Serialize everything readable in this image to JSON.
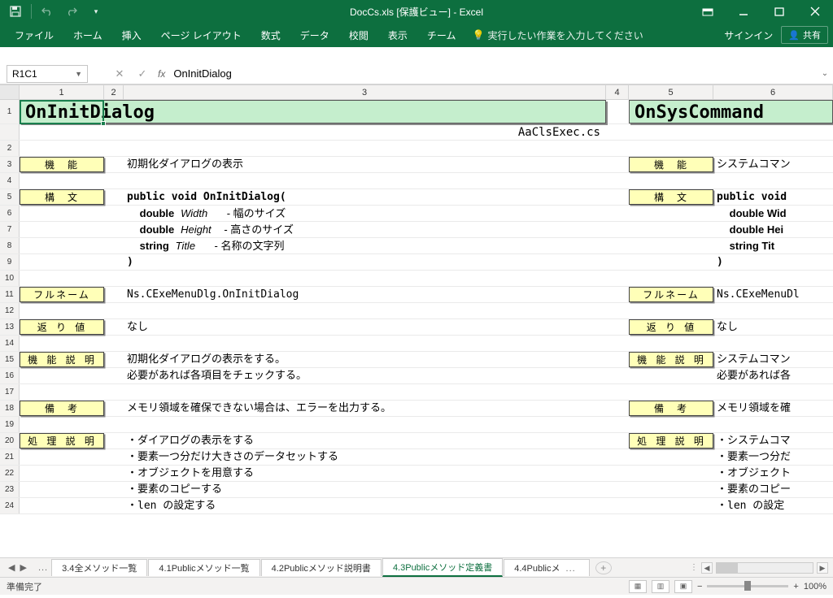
{
  "title": "DocCs.xls [保護ビュー] - Excel",
  "qat": {
    "save": "save",
    "undo": "undo",
    "redo": "redo"
  },
  "ribbon": {
    "file": "ファイル",
    "tabs": [
      "ホーム",
      "挿入",
      "ページ レイアウト",
      "数式",
      "データ",
      "校閲",
      "表示",
      "チーム"
    ],
    "tell": "実行したい作業を入力してください",
    "signin": "サインイン",
    "share": "共有"
  },
  "namebox": "R1C1",
  "formula": "OnInitDialog",
  "columns": [
    "1",
    "2",
    "3",
    "4",
    "5",
    "6"
  ],
  "sheet": {
    "left": {
      "title": "OnInitDialog",
      "file": "AaClsExec.cs",
      "r3_label": "機　能",
      "r3_text": "初期化ダイアログの表示",
      "r5_label": "構　文",
      "r5_text": "public void OnInitDialog(",
      "r6_text_a": "double",
      "r6_text_b": "Width",
      "r6_text_c": "- 幅のサイズ",
      "r7_text_a": "double",
      "r7_text_b": "Height",
      "r7_text_c": "- 高さのサイズ",
      "r8_text_a": "string",
      "r8_text_b": "Title",
      "r8_text_c": "- 名称の文字列",
      "r9_text": ")",
      "r11_label": "フルネーム",
      "r11_text": "Ns.CExeMenuDlg.OnInitDialog",
      "r13_label": "返 り 値",
      "r13_text": "なし",
      "r15_label": "機 能 説 明",
      "r15_text": "初期化ダイアログの表示をする。",
      "r16_text": "必要があれば各項目をチェックする。",
      "r18_label": "備　考",
      "r18_text": "メモリ領域を確保できない場合は、エラーを出力する。",
      "r20_label": "処 理 説 明",
      "r20_text": "・ダイアログの表示をする",
      "r21_text": "・要素一つ分だけ大きさのデータセットする",
      "r22_text": "・オブジェクトを用意する",
      "r23_text": "・要素のコピーする",
      "r24_text": "・len の設定する"
    },
    "right": {
      "title": "OnSysCommand",
      "r3_label": "機　能",
      "r3_text": "システムコマン",
      "r5_label": "構　文",
      "r5_text": "public void",
      "r6_text": "double Wid",
      "r7_text": "double Hei",
      "r8_text": "string Tit",
      "r11_label": "フルネーム",
      "r11_text": "Ns.CExeMenuDl",
      "r13_label": "返 り 値",
      "r13_text": "なし",
      "r15_label": "機 能 説 明",
      "r15_text": "システムコマン",
      "r16_text": "必要があれば各",
      "r18_label": "備　考",
      "r18_text": "メモリ領域を確",
      "r20_label": "処 理 説 明",
      "r20_text": "・システムコマ",
      "r21_text": "・要素一つ分だ",
      "r22_text": "・オブジェクト",
      "r23_text": "・要素のコピー",
      "r24_text": "・len の設定"
    }
  },
  "tabs": {
    "t1": "3.4全メソッド一覧",
    "t2": "4.1Publicメソッド一覧",
    "t3": "4.2Publicメソッド説明書",
    "t4": "4.3Publicメソッド定義書",
    "t5": "4.4Publicメ"
  },
  "status": {
    "ready": "準備完了",
    "zoom": "100%"
  }
}
